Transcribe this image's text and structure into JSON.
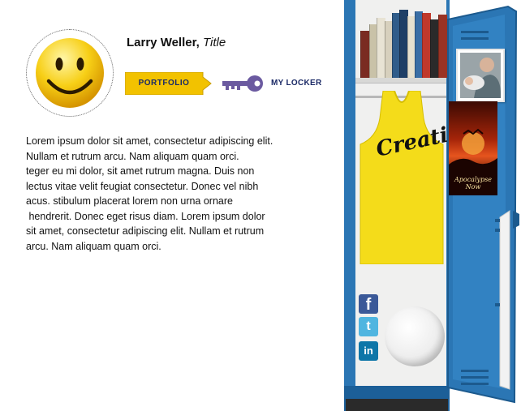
{
  "profile": {
    "name": "Larry Weller,",
    "title": "Title"
  },
  "nav": {
    "portfolio_label": "PORTFOLIO",
    "my_locker_label": "MY LOCKER"
  },
  "bio": {
    "lines": [
      "Lorem ipsum dolor sit amet, consectetur adipiscing elit.",
      "Nullam et rutrum arcu. Nam aliquam quam orci.",
      "teger eu mi dolor, sit amet rutrum magna. Duis non",
      "lectus vitae velit feugiat consectetur. Donec vel nibh",
      "acus. stibulum placerat lorem non urna ornare",
      " hendrerit. Donec eget risus diam. Lorem ipsum dolor",
      "sit amet, consectetur adipiscing elit. Nullam et rutrum",
      "arcu. Nam aliquam quam orci."
    ]
  },
  "locker": {
    "shirt_text": "Creative",
    "poster_title": "Apocalypse Now"
  },
  "social": {
    "facebook_glyph": "f",
    "twitter_glyph": "t",
    "linkedin_glyph": "in"
  },
  "colors": {
    "accent_yellow": "#f2c200",
    "nav_text": "#1b2a66",
    "key": "#6b5aa0",
    "locker_blue": "#2b76b4"
  },
  "icons": {
    "avatar": "smiley-face",
    "locker_link": "key-icon",
    "facebook": "facebook-icon",
    "twitter": "twitter-icon",
    "linkedin": "linkedin-icon"
  }
}
